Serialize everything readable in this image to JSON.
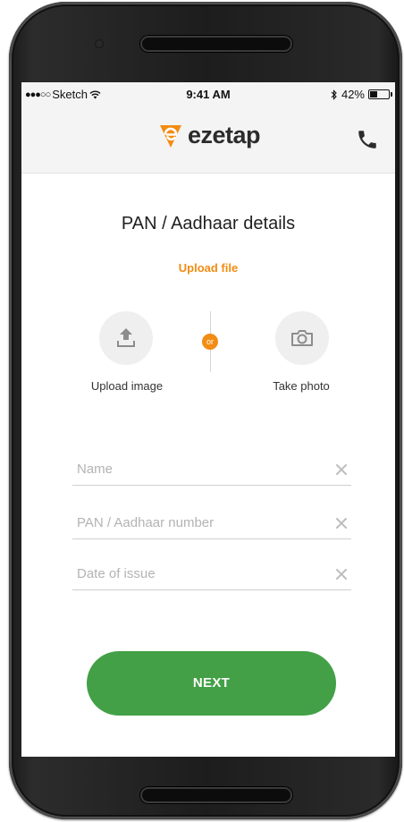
{
  "status_bar": {
    "carrier": "Sketch",
    "time": "9:41 AM",
    "battery_percent": "42%",
    "battery_level": 0.42
  },
  "header": {
    "brand_name": "ezetap",
    "brand_color": "#f28c13"
  },
  "page": {
    "title": "PAN / Aadhaar details",
    "upload_file_link": "Upload file",
    "upload_caption": "Upload image",
    "or_label": "or",
    "photo_caption": "Take photo"
  },
  "form": {
    "name_placeholder": "Name",
    "pan_placeholder": "PAN / Aadhaar number",
    "date_placeholder": "Date of issue"
  },
  "actions": {
    "next_label": "NEXT",
    "next_color": "#43a047"
  }
}
